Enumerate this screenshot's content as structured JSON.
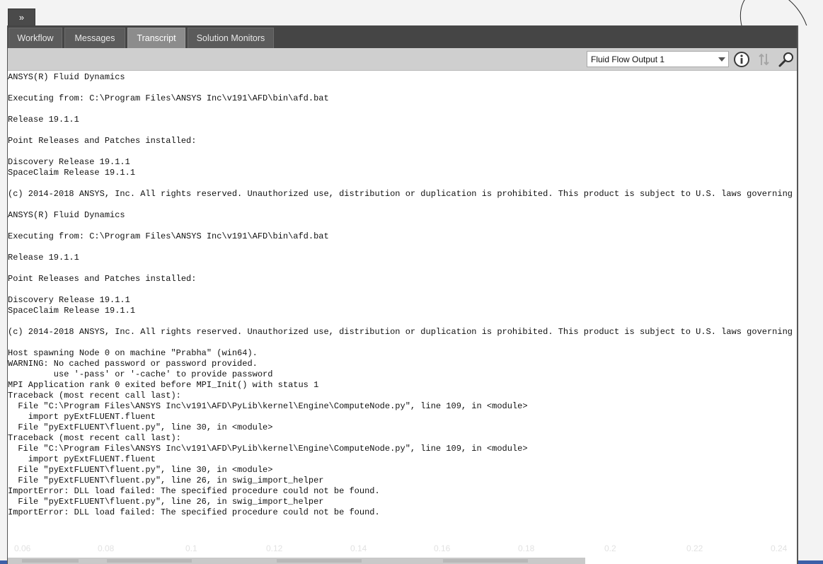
{
  "tabs": [
    {
      "label": "Workflow",
      "active": false
    },
    {
      "label": "Messages",
      "active": false
    },
    {
      "label": "Transcript",
      "active": true
    },
    {
      "label": "Solution Monitors",
      "active": false
    }
  ],
  "toolbar": {
    "output_select_value": "Fluid Flow Output 1",
    "icons": [
      "info-icon",
      "sort-arrows-icon",
      "search-icon"
    ]
  },
  "transcript": {
    "text": "ANSYS(R) Fluid Dynamics\n\nExecuting from: C:\\Program Files\\ANSYS Inc\\v191\\AFD\\bin\\afd.bat\n\nRelease 19.1.1\n\nPoint Releases and Patches installed:\n\nDiscovery Release 19.1.1\nSpaceClaim Release 19.1.1\n\n(c) 2014-2018 ANSYS, Inc. All rights reserved. Unauthorized use, distribution or duplication is prohibited. This product is subject to U.S. laws governing expor\n\nANSYS(R) Fluid Dynamics\n\nExecuting from: C:\\Program Files\\ANSYS Inc\\v191\\AFD\\bin\\afd.bat\n\nRelease 19.1.1\n\nPoint Releases and Patches installed:\n\nDiscovery Release 19.1.1\nSpaceClaim Release 19.1.1\n\n(c) 2014-2018 ANSYS, Inc. All rights reserved. Unauthorized use, distribution or duplication is prohibited. This product is subject to U.S. laws governing expor\n\nHost spawning Node 0 on machine \"Prabha\" (win64).\nWARNING: No cached password or password provided.\n         use '-pass' or '-cache' to provide password\nMPI Application rank 0 exited before MPI_Init() with status 1\nTraceback (most recent call last):\n  File \"C:\\Program Files\\ANSYS Inc\\v191\\AFD\\PyLib\\kernel\\Engine\\ComputeNode.py\", line 109, in <module>\n    import pyExtFLUENT.fluent\n  File \"pyExtFLUENT\\fluent.py\", line 30, in <module>\nTraceback (most recent call last):\n  File \"C:\\Program Files\\ANSYS Inc\\v191\\AFD\\PyLib\\kernel\\Engine\\ComputeNode.py\", line 109, in <module>\n    import pyExtFLUENT.fluent\n  File \"pyExtFLUENT\\fluent.py\", line 30, in <module>\n  File \"pyExtFLUENT\\fluent.py\", line 26, in swig_import_helper\nImportError: DLL load failed: The specified procedure could not be found.\n  File \"pyExtFLUENT\\fluent.py\", line 26, in swig_import_helper\nImportError: DLL load failed: The specified procedure could not be found."
  },
  "axis_ticks": [
    "0.06",
    "0.08",
    "0.1",
    "0.12",
    "0.14",
    "0.16",
    "0.18",
    "0.2",
    "0.22",
    "0.24"
  ],
  "colors": {
    "tabbar": "#454545",
    "active_tab": "#8c8c8c",
    "toolbar": "#cfcfcf"
  }
}
